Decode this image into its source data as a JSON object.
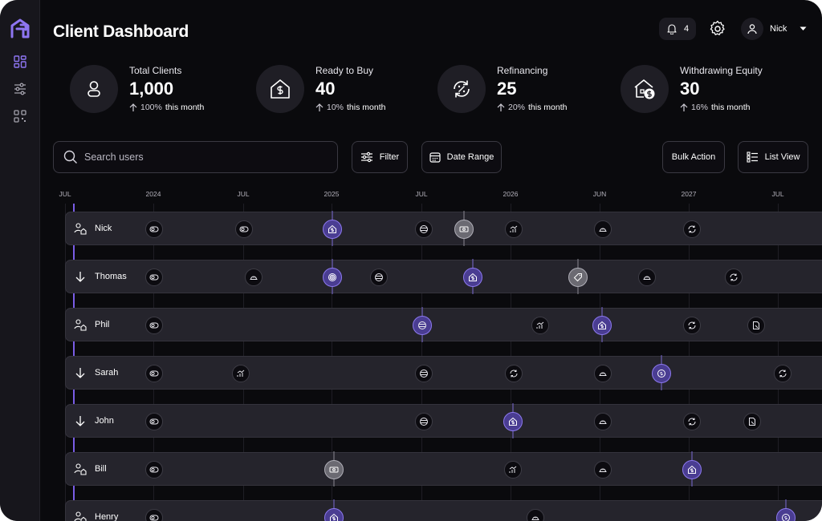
{
  "header": {
    "title": "Client Dashboard",
    "notification_count": "4",
    "user_name": "Nick"
  },
  "stats": [
    {
      "label": "Total Clients",
      "value": "1,000",
      "change": "100%",
      "change_suffix": "this month",
      "icon": "user-icon"
    },
    {
      "label": "Ready to Buy",
      "value": "40",
      "change": "10%",
      "change_suffix": "this month",
      "icon": "house-dollar-icon"
    },
    {
      "label": "Refinancing",
      "value": "25",
      "change": "20%",
      "change_suffix": "this month",
      "icon": "refresh-percent-icon"
    },
    {
      "label": "Withdrawing Equity",
      "value": "30",
      "change": "16%",
      "change_suffix": "this month",
      "icon": "house-coin-icon"
    }
  ],
  "toolbar": {
    "search_placeholder": "Search users",
    "filter_label": "Filter",
    "date_range_label": "Date Range",
    "bulk_action_label": "Bulk Action",
    "list_view_label": "List View"
  },
  "timeline": {
    "ticks": [
      "JUL",
      "2024",
      "JUL",
      "2025",
      "JUL",
      "2026",
      "JUN",
      "2027",
      "JUL"
    ],
    "rows": [
      {
        "name": "Nick",
        "status_icon": "user-house-icon"
      },
      {
        "name": "Thomas",
        "status_icon": "arrow-down-icon"
      },
      {
        "name": "Phil",
        "status_icon": "user-house-icon"
      },
      {
        "name": "Sarah",
        "status_icon": "arrow-down-icon"
      },
      {
        "name": "John",
        "status_icon": "arrow-down-icon"
      },
      {
        "name": "Bill",
        "status_icon": "user-house-icon"
      },
      {
        "name": "Henry",
        "status_icon": "user-house-icon"
      }
    ]
  },
  "colors": {
    "accent": "#7a5de6",
    "background": "#0a0a0d",
    "row": "#25242c"
  }
}
